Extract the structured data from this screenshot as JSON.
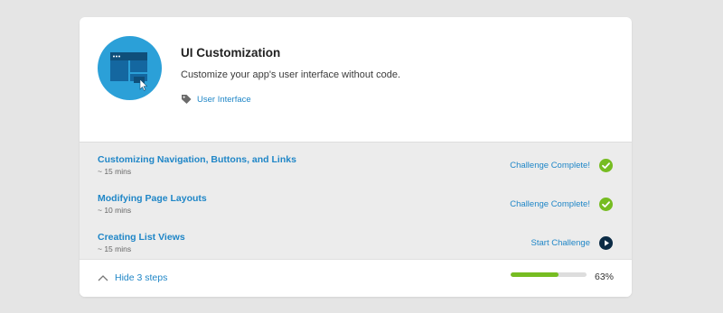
{
  "module": {
    "title": "UI Customization",
    "description": "Customize your app's user interface without code.",
    "tag": {
      "label": "User Interface",
      "icon": "tag-icon"
    },
    "icon": "window-layout-icon"
  },
  "steps": [
    {
      "title": "Customizing Navigation, Buttons, and Links",
      "time": "~ 15 mins",
      "status": "Challenge Complete!",
      "status_icon": "check-circle-icon"
    },
    {
      "title": "Modifying Page Layouts",
      "time": "~ 10 mins",
      "status": "Challenge Complete!",
      "status_icon": "check-circle-icon"
    },
    {
      "title": "Creating List Views",
      "time": "~ 15 mins",
      "status": "Start Challenge",
      "status_icon": "play-circle-icon"
    }
  ],
  "footer": {
    "toggle_label": "Hide 3 steps",
    "progress_percent": 63,
    "progress_label": "63%"
  },
  "colors": {
    "accent": "#1f86c7",
    "complete": "#76bc21",
    "start": "#0b2b45",
    "icon_bg": "#2ba0d8"
  }
}
